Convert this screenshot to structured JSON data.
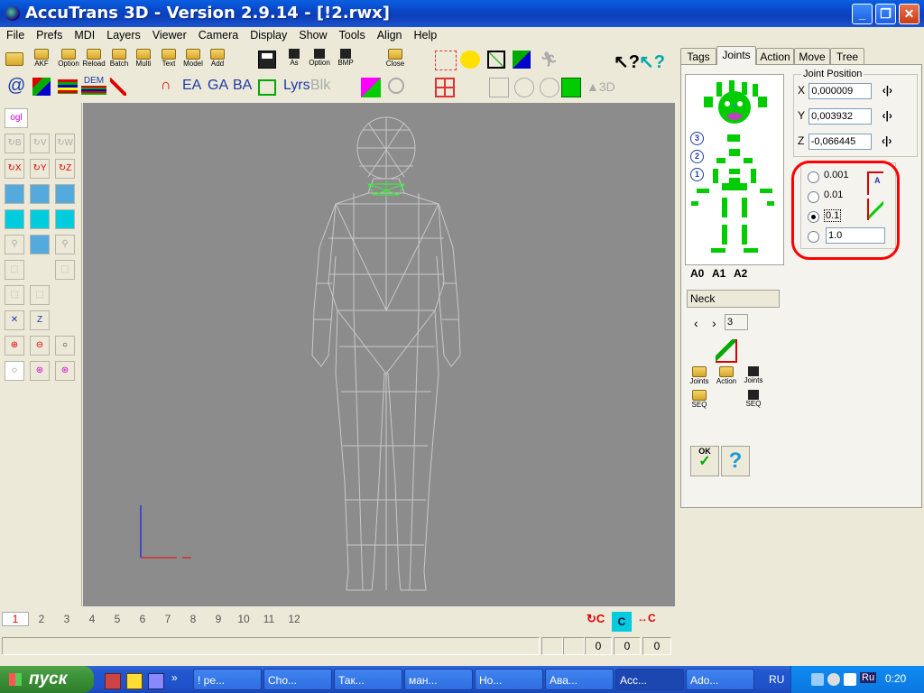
{
  "window": {
    "title": "AccuTrans 3D - Version 2.9.14 - [!2.rwx]"
  },
  "menu": [
    "File",
    "Prefs",
    "MDI",
    "Layers",
    "Viewer",
    "Camera",
    "Display",
    "Show",
    "Tools",
    "Align",
    "Help"
  ],
  "toolbar1": {
    "labels": [
      "AKF",
      "Option",
      "Reload",
      "Batch",
      "Multi",
      "Text",
      "Model",
      "Add",
      "As",
      "Option",
      "BMP",
      "Close"
    ]
  },
  "toolbar2": {
    "text": [
      "@",
      "DEM",
      "EA",
      "GA",
      "BA",
      "Lyrs",
      "Blk"
    ]
  },
  "left_tools": {
    "ogl": "ogl"
  },
  "right_panel": {
    "tabs": [
      "Tags",
      "Joints",
      "Action",
      "Move",
      "Tree"
    ],
    "active_tab": "Joints",
    "joint_position": {
      "label": "Joint Position",
      "x_label": "X",
      "x": "0,000009",
      "y_label": "Y",
      "y": "0,003932",
      "z_label": "Z",
      "z": "-0,066445"
    },
    "step_options": [
      "0.001",
      "0.01",
      "0.1"
    ],
    "selected_step": "0.1",
    "custom_step": "1.0",
    "markers": [
      "3",
      "2",
      "1"
    ],
    "anchors": [
      "A0",
      "A1",
      "A2"
    ],
    "joint_name": "Neck",
    "joint_index": "3",
    "buttons": {
      "joints_load": "Joints",
      "action_load": "Action",
      "joints_save": "Joints",
      "seq_load": "SEQ",
      "seq_save": "SEQ",
      "ok": "OK"
    }
  },
  "frames": [
    "1",
    "2",
    "3",
    "4",
    "5",
    "6",
    "7",
    "8",
    "9",
    "10",
    "11",
    "12"
  ],
  "status": {
    "v1": "0",
    "v2": "0",
    "v3": "0"
  },
  "taskbar": {
    "start": "пуск",
    "tasks": [
      "! ре...",
      "Cho...",
      "Так...",
      "ман...",
      "Но...",
      "Ава...",
      "Acc...",
      "Ado..."
    ],
    "lang": "RU",
    "tray_lang": "Ru",
    "clock": "0:20"
  },
  "colors": {
    "viewport": "#8c8c8c",
    "highlight_ring": "#ff0000",
    "figure": "#00e000"
  }
}
